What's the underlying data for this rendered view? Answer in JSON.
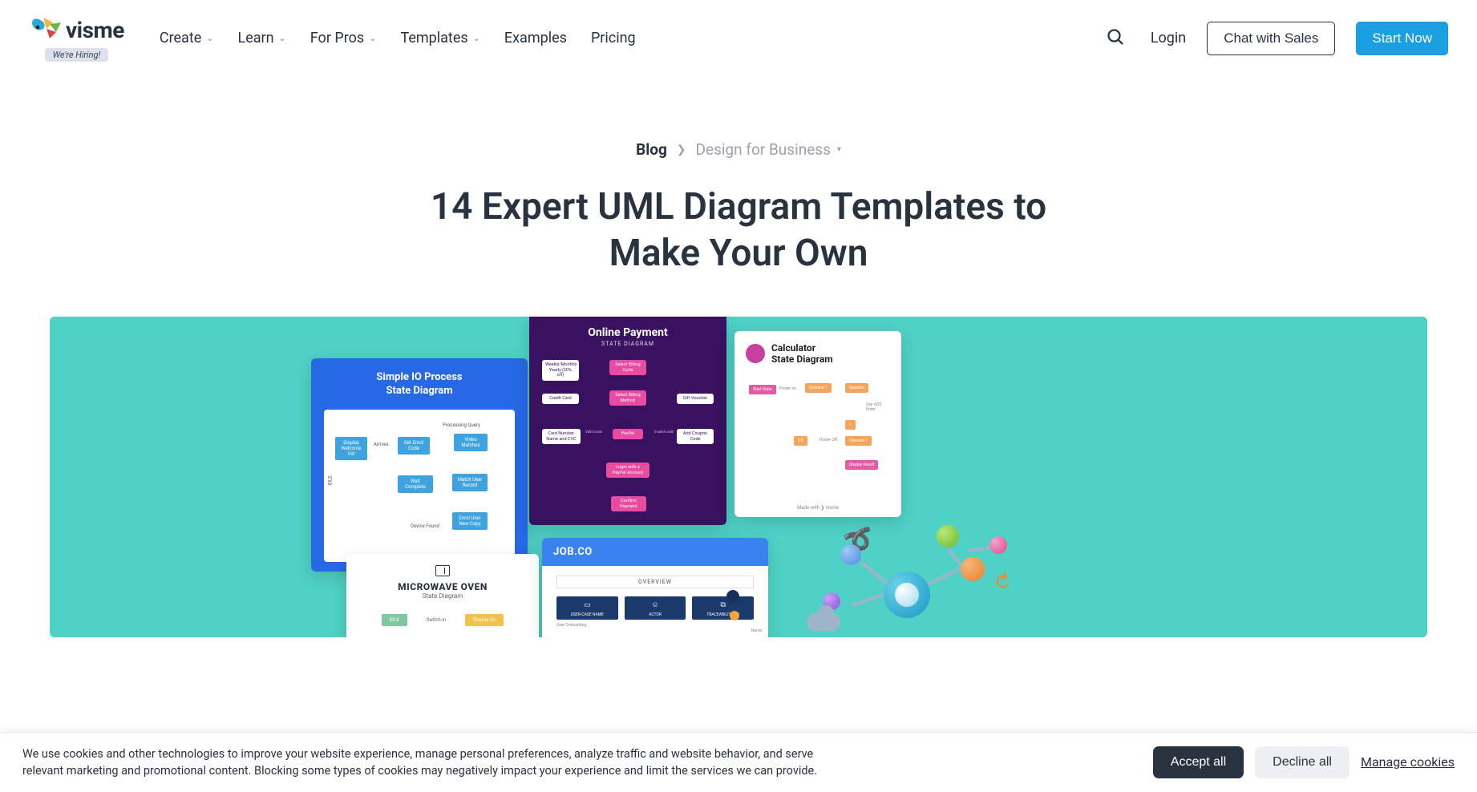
{
  "header": {
    "logo_text": "visme",
    "hiring": "We're Hiring!",
    "nav": {
      "create": "Create",
      "learn": "Learn",
      "for_pros": "For Pros",
      "templates": "Templates",
      "examples": "Examples",
      "pricing": "Pricing"
    },
    "login": "Login",
    "chat": "Chat with Sales",
    "start": "Start Now"
  },
  "breadcrumb": {
    "blog": "Blog",
    "category": "Design for Business"
  },
  "title": "14 Expert UML Diagram Templates to Make Your Own",
  "hero": {
    "cardA": {
      "title_l1": "Simple IO Process",
      "title_l2": "State Diagram",
      "idle_side": "IDLE",
      "arrives": "Arrives",
      "proc": "Processing Query",
      "dev": "Device Found",
      "box1": "Display Welcome Vid",
      "box2": "Get Enrol Code",
      "box3": "Video Matches",
      "box4": "Wait Complete",
      "box5": "Match User Record",
      "box6": "Enrol User New Copy"
    },
    "cardB": {
      "title": "Online Payment",
      "sub": "STATE DIAGRAM",
      "b1": "Weekly/Monthly Yearly (20% off)",
      "b2": "Select Billing Cycle",
      "b3": "Credit Card",
      "b4": "Select Billing Method",
      "b5": "Gift Voucher",
      "b6": "Card Number, Name and CVC",
      "b7": "PayPal",
      "b8": "Add Coupon Code",
      "b9": "Login with a PayPal Account",
      "b10": "Confirm Payment",
      "valid": "Valid code",
      "invalid": "Invalid code"
    },
    "cardC": {
      "title_l1": "Calculator",
      "title_l2": "State Diagram",
      "s1": "Start State",
      "s2": "Power on",
      "s3": "Operand 1",
      "s4": "Operator",
      "s5": "=",
      "s6": "Operand 2",
      "s7": "Display Result",
      "s8": "Off",
      "s9": "Power Off",
      "note": "Use AOS Enter",
      "ftr": "Made with ❯ visme"
    },
    "cardD": {
      "title": "MICROWAVE OVEN",
      "sub": "State Diagram",
      "idle": "IDLE",
      "switch": "Switch-in",
      "disp": "Display On"
    },
    "cardE": {
      "title": "JOB.CO",
      "overview": "OVERVIEW",
      "c1": "USER-CASE NAME",
      "c2": "ACTOR",
      "c3": "TRACEABILITY TO",
      "cap": "User Onboarding",
      "name": "Name"
    }
  },
  "cookie": {
    "text": "We use cookies and other technologies to improve your website experience, manage personal preferences, analyze traffic and website behavior, and serve relevant marketing and promotional content. Blocking some types of cookies may negatively impact your experience and limit the services we can provide.",
    "accept": "Accept all",
    "decline": "Decline all",
    "manage": "Manage cookies"
  }
}
